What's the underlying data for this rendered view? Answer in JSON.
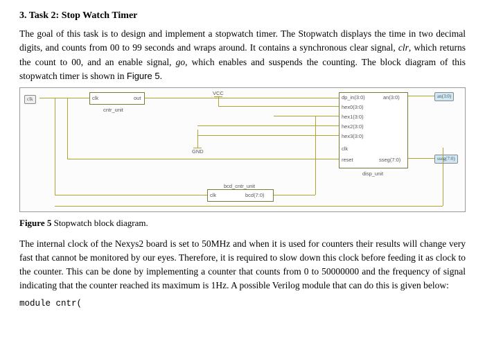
{
  "heading": "3. Task 2: Stop Watch Timer",
  "para1_pre": "The goal of this task is to design and implement a stopwatch timer. The Stopwatch displays the time in two decimal digits, and counts from 00 to 99 seconds and wraps around. It contains a synchronous clear signal, ",
  "clr": "clr",
  "para1_mid1": ", which returns the count to 00, and an enable signal, ",
  "go": "go",
  "para1_mid2": ", which enables and suspends the counting. The block diagram of this stopwatch timer is shown in ",
  "figref": "Figure 5",
  "para1_end": ".",
  "diagram": {
    "clk_in": "clk",
    "cntr_unit": "cntr_unit",
    "cntr_clk": "clk",
    "cntr_out": "out",
    "vcc": "VCC",
    "gnd": "GND",
    "bcd_cntr_unit": "bcd_cntr_unit",
    "bcd_clk": "clk",
    "bcd_out": "bcd(7:0)",
    "disp_unit": "disp_unit",
    "dp_in": "dp_in(3:0)",
    "an_in": "an(3:0)",
    "hex0": "hex0(3:0)",
    "hex1": "hex1(3:0)",
    "hex2": "hex2(3:0)",
    "hex3": "hex3(3:0)",
    "disp_clk": "clk",
    "reset": "reset",
    "sseg": "sseg(7:0)",
    "an_out": "an(3:0)",
    "sseg_out": "sseg(7:0)"
  },
  "caption_b": "Figure 5",
  "caption_rest": " Stopwatch block diagram.",
  "para2": "The internal clock of the Nexys2 board is set to 50MHz and when it is used for counters their results will change very fast that cannot be monitored by our eyes. Therefore, it is required to slow down this clock before feeding it as clock to the counter. This can be done by implementing a counter that counts from 0 to 50000000 and the frequency of signal indicating that the counter reached its maximum is 1Hz. A possible Verilog module that can do this is given below:",
  "code": "module cntr("
}
